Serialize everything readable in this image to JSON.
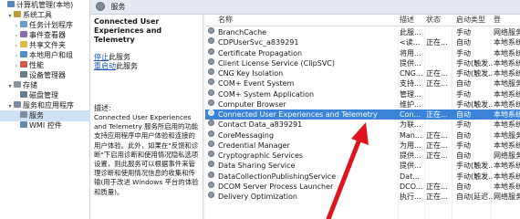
{
  "tree": {
    "items": [
      {
        "label": "计算机管理(本地)",
        "icon": "computer-icon",
        "indent": 0,
        "twisty": ""
      },
      {
        "label": "系统工具",
        "icon": "tools-icon",
        "indent": 1,
        "twisty": "▾"
      },
      {
        "label": "任务计划程序",
        "icon": "clock-icon",
        "indent": 2,
        "twisty": "›"
      },
      {
        "label": "事件查看器",
        "icon": "event-icon",
        "indent": 2,
        "twisty": "›"
      },
      {
        "label": "共享文件夹",
        "icon": "folder-icon",
        "indent": 2,
        "twisty": "›"
      },
      {
        "label": "本地用户和组",
        "icon": "users-icon",
        "indent": 2,
        "twisty": "›"
      },
      {
        "label": "性能",
        "icon": "performance-icon",
        "indent": 2,
        "twisty": "›"
      },
      {
        "label": "设备管理器",
        "icon": "device-icon",
        "indent": 2,
        "twisty": ""
      },
      {
        "label": "存储",
        "icon": "storage-icon",
        "indent": 1,
        "twisty": "▾"
      },
      {
        "label": "磁盘管理",
        "icon": "disk-icon",
        "indent": 2,
        "twisty": ""
      },
      {
        "label": "服务和应用程序",
        "icon": "services-apps-icon",
        "indent": 1,
        "twisty": "▾"
      },
      {
        "label": "服务",
        "icon": "gear-icon",
        "indent": 2,
        "twisty": "",
        "selected": true
      },
      {
        "label": "WMI 控件",
        "icon": "wmi-icon",
        "indent": 2,
        "twisty": ""
      }
    ]
  },
  "header": {
    "title": "服务"
  },
  "description_pane": {
    "service_title": "Connected User Experiences and Telemetry",
    "link_stop": "停止",
    "link_stop_suffix": "此服务",
    "link_restart": "重启动",
    "link_restart_suffix": "此服务",
    "label": "描述:",
    "text": "Connected User Experiences and Telemetry 服务所启用的功能支持应用程序中用户体验和连接的用户体验。此外，如果在\"反馈和诊断\"下启用诊断和使用情况隐私选项设置，则此服务可以根据事件来管理诊断和使用情况信息的收集和传输(用于改进 Windows 平台的体验和质量)。"
  },
  "columns": {
    "name": "名称",
    "description": "描述",
    "state": "状态",
    "startup": "启动类型",
    "logon": "登"
  },
  "services": [
    {
      "name": "BranchCache",
      "desc": "此服...",
      "state": "",
      "startup": "手动",
      "logon": "网络服务"
    },
    {
      "name": "CDPUserSvc_a839291",
      "desc": "<读...",
      "state": "正在...",
      "startup": "自动",
      "logon": "本地系统"
    },
    {
      "name": "Certificate Propagation",
      "desc": "将用...",
      "state": "",
      "startup": "手动",
      "logon": "本地系统"
    },
    {
      "name": "Client License Service (ClipSVC)",
      "desc": "提供...",
      "state": "",
      "startup": "手动(触发...",
      "logon": "本地系统"
    },
    {
      "name": "CNG Key Isolation",
      "desc": "CNG...",
      "state": "正在...",
      "startup": "手动(触发...",
      "logon": "本地系统"
    },
    {
      "name": "COM+ Event System",
      "desc": "支持...",
      "state": "正在...",
      "startup": "自动",
      "logon": "本地服务"
    },
    {
      "name": "COM+ System Application",
      "desc": "管理...",
      "state": "",
      "startup": "手动",
      "logon": "本地系统"
    },
    {
      "name": "Computer Browser",
      "desc": "维护...",
      "state": "",
      "startup": "手动(触发...",
      "logon": "本地系统"
    },
    {
      "name": "Connected User Experiences and Telemetry",
      "desc": "Con...",
      "state": "正在...",
      "startup": "自动",
      "logon": "本地系统",
      "selected": true
    },
    {
      "name": "Contact Data_a839291",
      "desc": "为联...",
      "state": "",
      "startup": "手动",
      "logon": "本地系统"
    },
    {
      "name": "CoreMessaging",
      "desc": "Man...",
      "state": "正在...",
      "startup": "自动",
      "logon": "本地服务"
    },
    {
      "name": "Credential Manager",
      "desc": "为用...",
      "state": "正在...",
      "startup": "手动",
      "logon": "本地系统"
    },
    {
      "name": "Cryptographic Services",
      "desc": "提供...",
      "state": "正在...",
      "startup": "自动",
      "logon": "网络服务"
    },
    {
      "name": "Data Sharing Service",
      "desc": "提供...",
      "state": "",
      "startup": "手动(触发...",
      "logon": "本地系统"
    },
    {
      "name": "DataCollectionPublishingService",
      "desc": "Dat...",
      "state": "",
      "startup": "手动(触发...",
      "logon": "本地系统"
    },
    {
      "name": "DCOM Server Process Launcher",
      "desc": "DCO...",
      "state": "正在...",
      "startup": "自动",
      "logon": "本地系统"
    },
    {
      "name": "Delivery Optimization",
      "desc": "执行...",
      "state": "正在...",
      "startup": "自动(延迟...",
      "logon": "网络服务"
    }
  ],
  "colors": {
    "selection": "#3a83d8",
    "link": "#1a56b8",
    "annotation_arrow": "#e0141e"
  }
}
